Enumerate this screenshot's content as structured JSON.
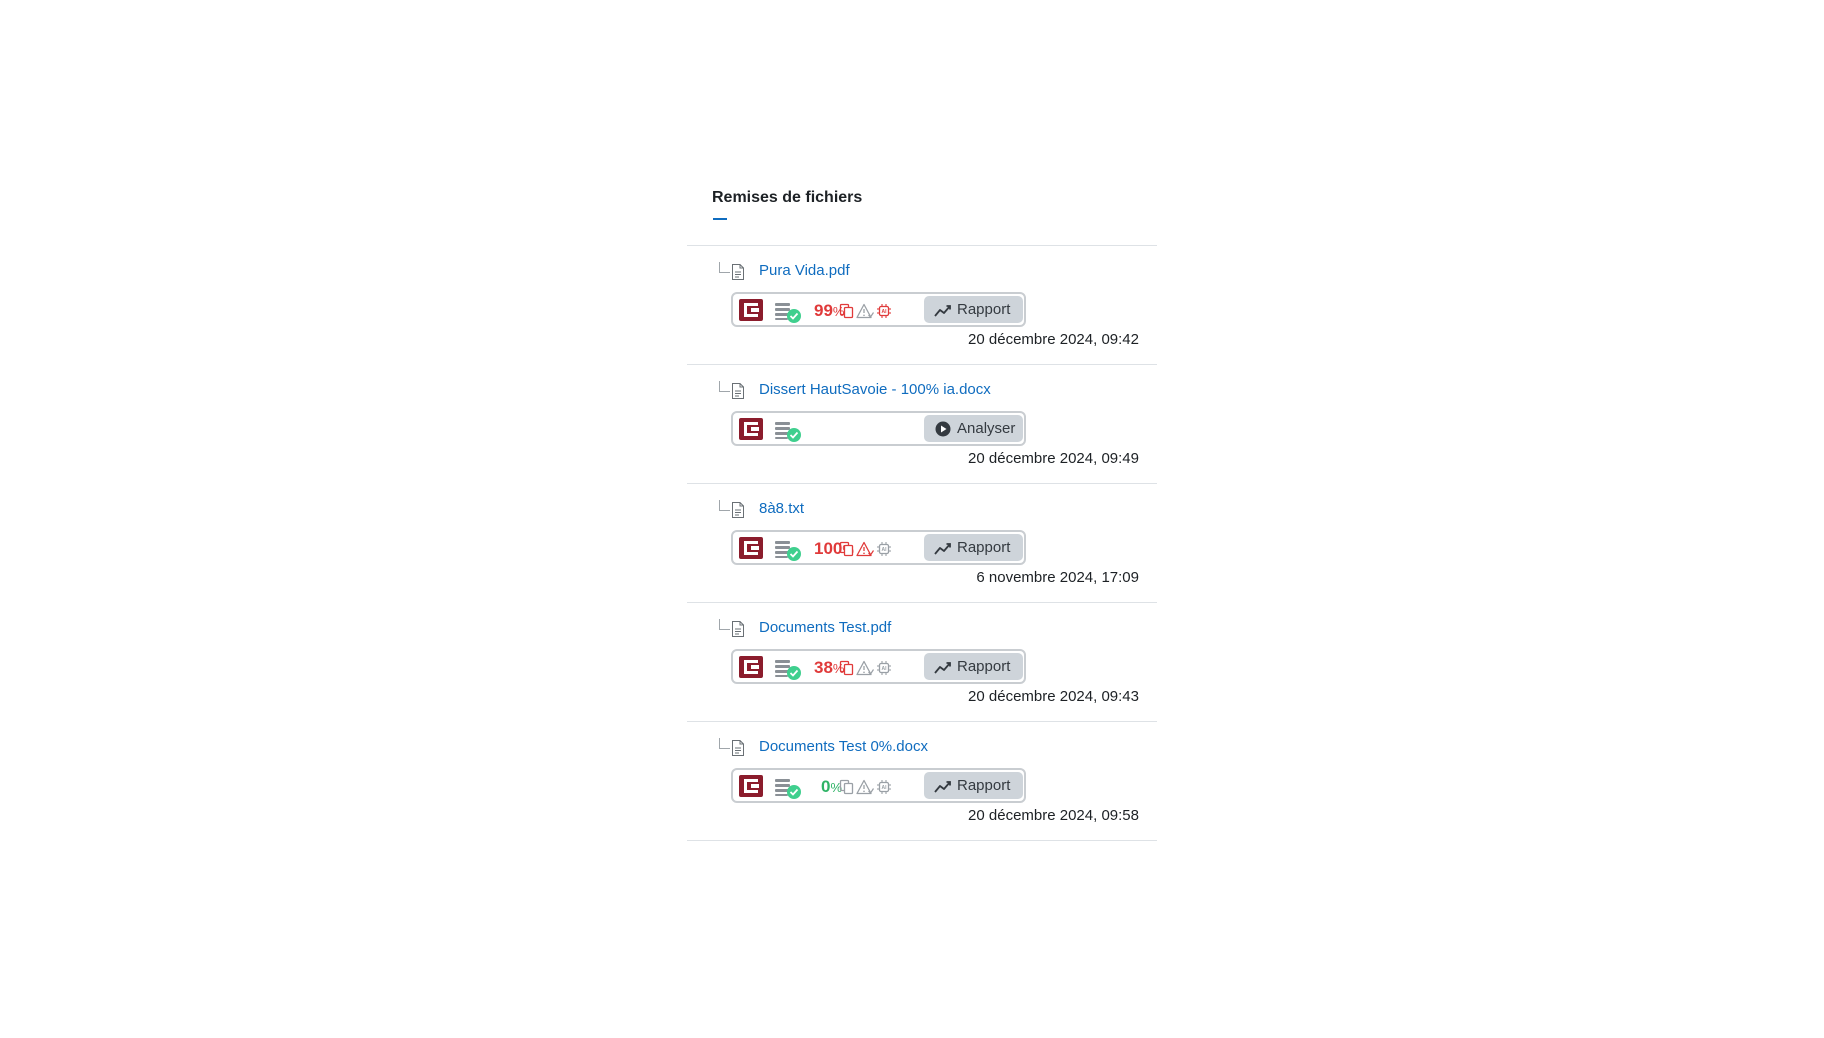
{
  "section": {
    "title": "Remises de fichiers"
  },
  "colors": {
    "link": "#0f6cbf",
    "high_score": "#e03a3a",
    "low_score": "#2fb366",
    "brand": "#8b1c2c",
    "button_bg": "#ced4da"
  },
  "submissions": [
    {
      "file_name": "Pura Vida.pdf",
      "file_icon": "pdf-file-icon",
      "score_value": "99",
      "score_unit": "%",
      "score_color": "#e03a3a",
      "copy_icon_active": true,
      "warning_icon_active": false,
      "ai_icon_active": true,
      "action_label": "Rapport",
      "action_icon": "chart-line-icon",
      "date": "20 décembre 2024, 09:42"
    },
    {
      "file_name": "Dissert HautSavoie - 100% ia.docx",
      "file_icon": "doc-file-icon",
      "score_value": "",
      "score_unit": "",
      "score_color": "#e03a3a",
      "action_label": "Analyser",
      "action_icon": "play-circle-icon",
      "date": "20 décembre 2024, 09:49"
    },
    {
      "file_name": "8à8.txt",
      "file_icon": "text-file-icon",
      "score_value": "100",
      "score_unit": "%",
      "score_color": "#e03a3a",
      "copy_icon_active": true,
      "warning_icon_active": true,
      "ai_icon_active": false,
      "action_label": "Rapport",
      "action_icon": "chart-line-icon",
      "date": "6 novembre 2024, 17:09"
    },
    {
      "file_name": "Documents Test.pdf",
      "file_icon": "pdf-file-icon",
      "score_value": "38",
      "score_unit": "%",
      "score_color": "#e03a3a",
      "copy_icon_active": true,
      "warning_icon_active": false,
      "ai_icon_active": false,
      "action_label": "Rapport",
      "action_icon": "chart-line-icon",
      "date": "20 décembre 2024, 09:43"
    },
    {
      "file_name": "Documents Test 0%.docx",
      "file_icon": "doc-file-icon",
      "score_value": "0",
      "score_unit": "%",
      "score_color": "#2fb366",
      "copy_icon_active": false,
      "warning_icon_active": false,
      "ai_icon_active": false,
      "action_label": "Rapport",
      "action_icon": "chart-line-icon",
      "date": "20 décembre 2024, 09:58"
    }
  ]
}
